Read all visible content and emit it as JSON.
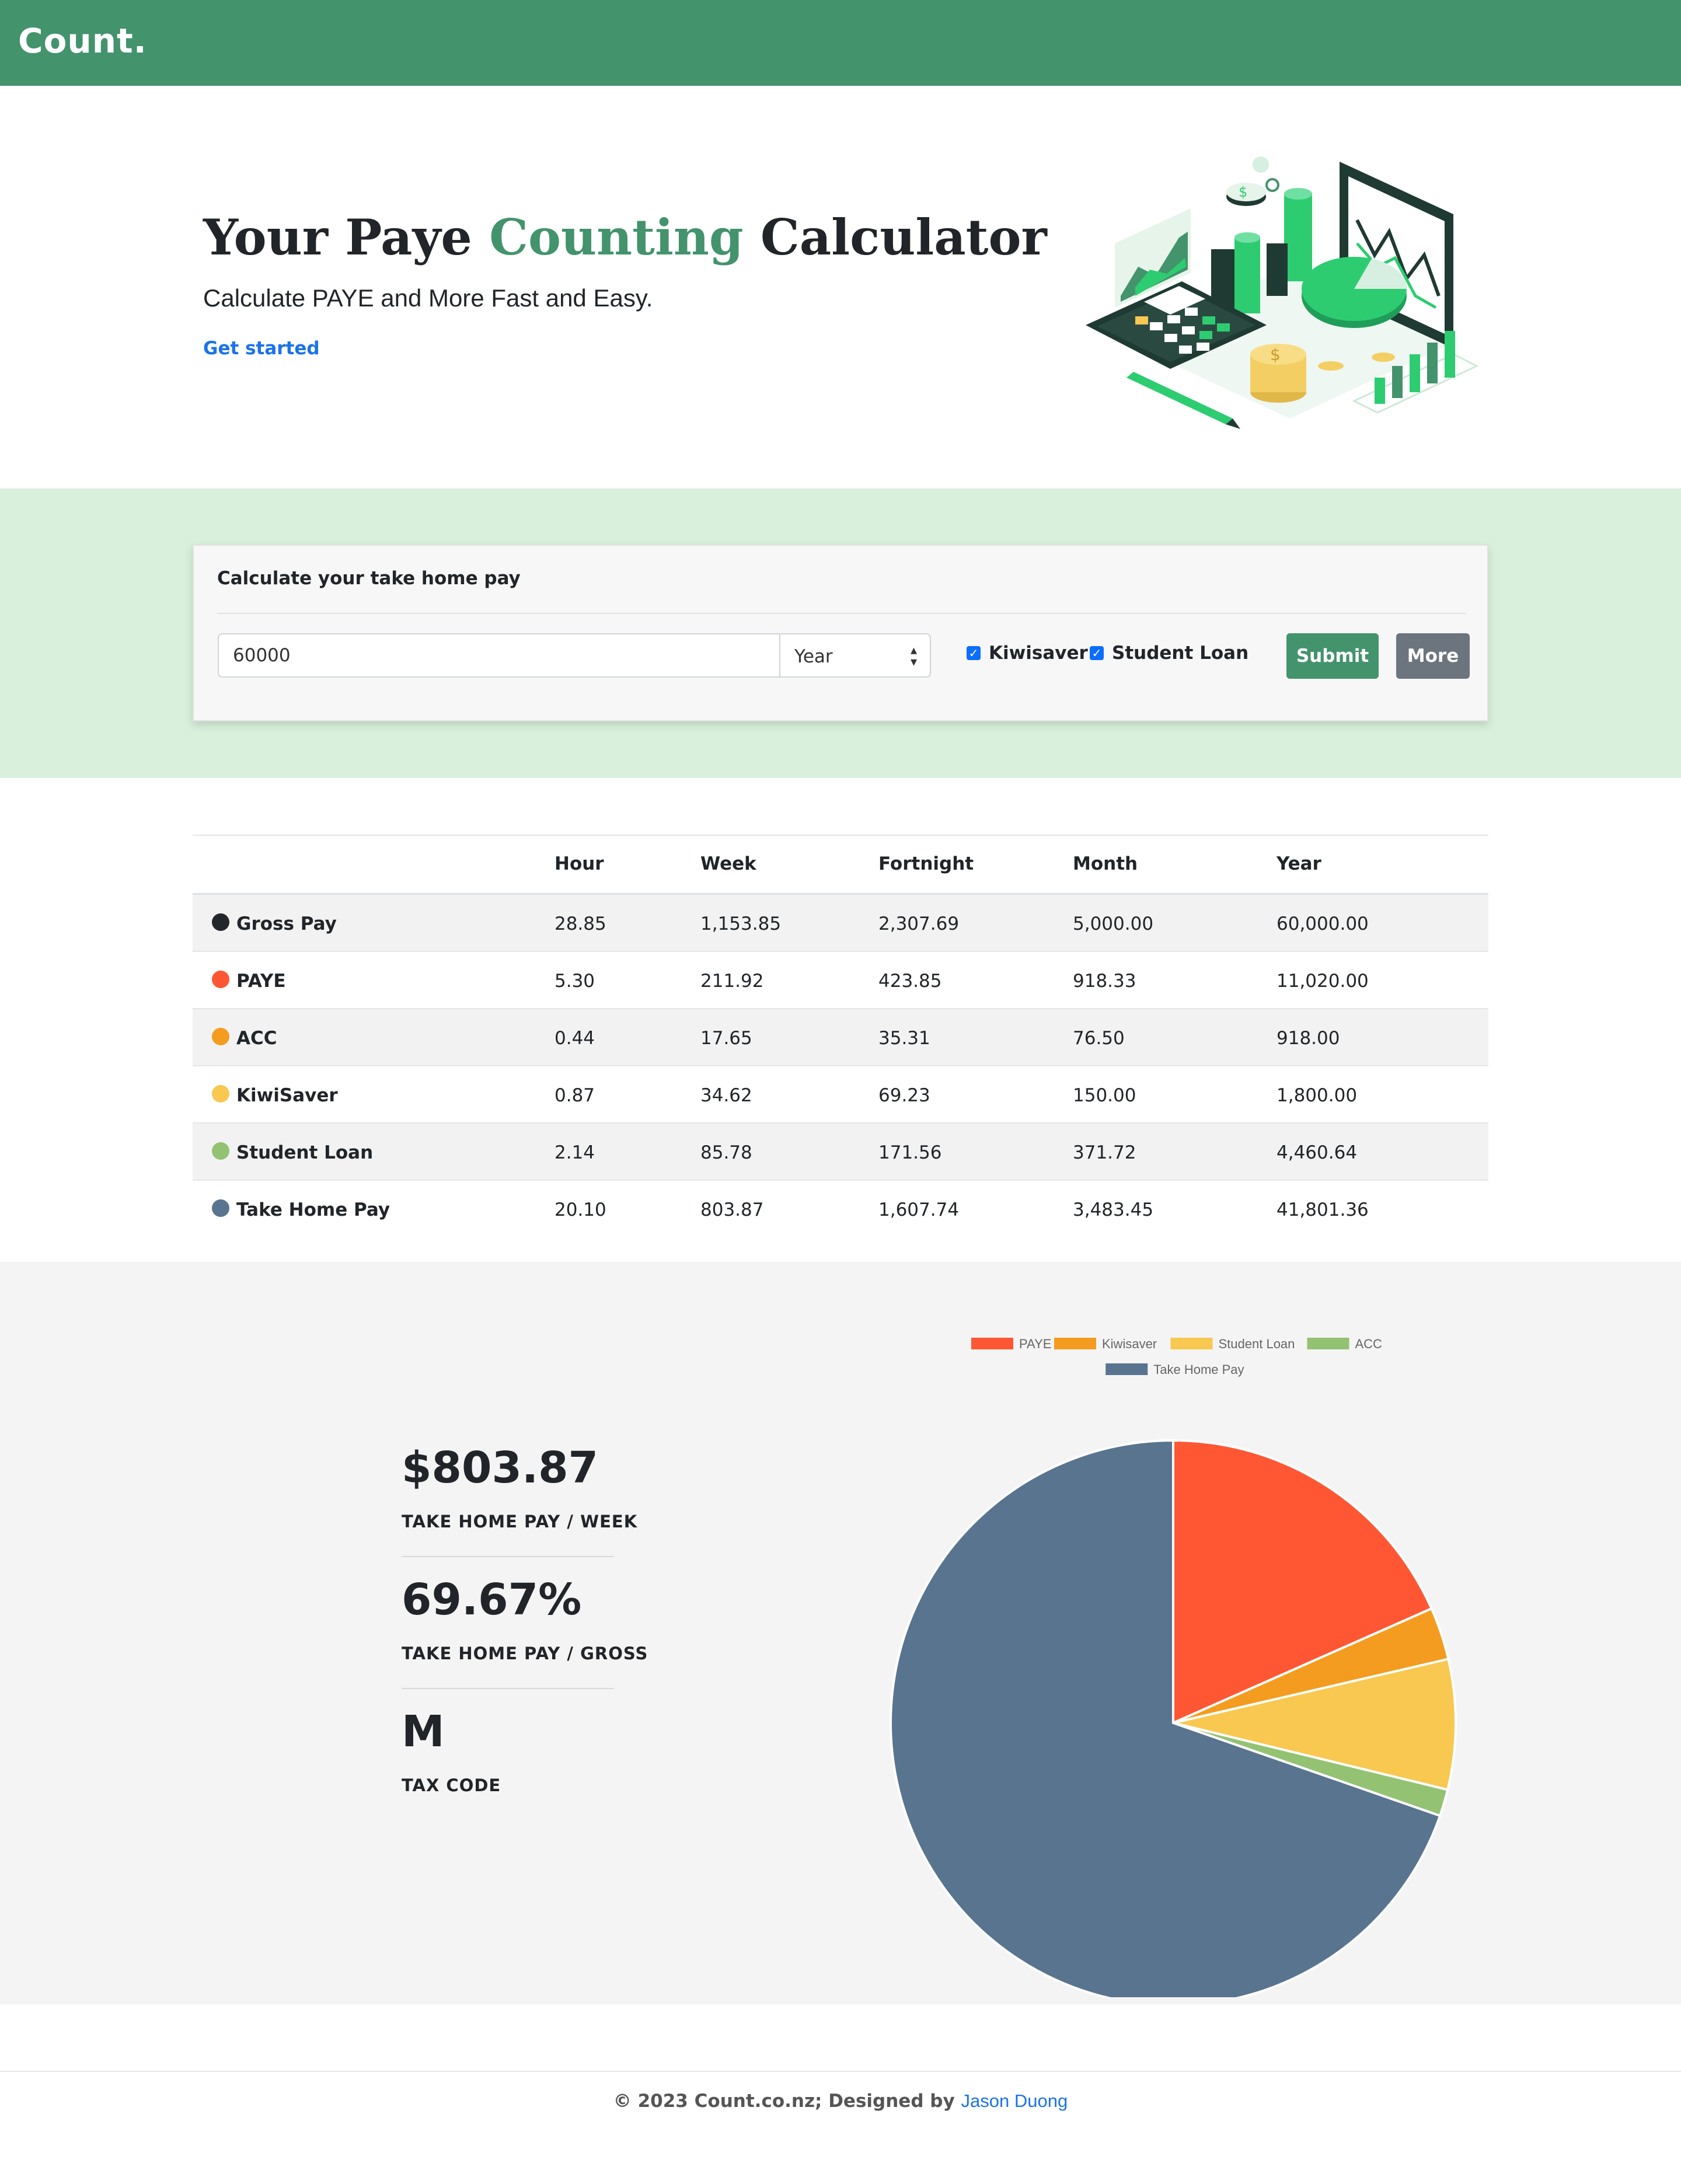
{
  "navbar": {
    "brand": "Count."
  },
  "hero": {
    "title_part1": "Your Paye ",
    "title_accent": "Counting",
    "title_part2": " Calculator",
    "subtitle": "Calculate PAYE and More Fast and Easy.",
    "cta": "Get started"
  },
  "calculator": {
    "title": "Calculate your take home pay",
    "salary_value": "60000",
    "period_selected": "Year",
    "kiwisaver_label": "Kiwisaver",
    "kiwisaver_checked": true,
    "student_loan_label": "Student Loan",
    "student_loan_checked": true,
    "submit_label": "Submit",
    "more_label": "More"
  },
  "results": {
    "headers": [
      "Hour",
      "Week",
      "Fortnight",
      "Month",
      "Year"
    ],
    "rows": [
      {
        "label": "Gross Pay",
        "color": "#23272b",
        "values": [
          "28.85",
          "1,153.85",
          "2,307.69",
          "5,000.00",
          "60,000.00"
        ]
      },
      {
        "label": "PAYE",
        "color": "#ff5733",
        "values": [
          "5.30",
          "211.92",
          "423.85",
          "918.33",
          "11,020.00"
        ]
      },
      {
        "label": "ACC",
        "color": "#f39c1f",
        "values": [
          "0.44",
          "17.65",
          "35.31",
          "76.50",
          "918.00"
        ]
      },
      {
        "label": "KiwiSaver",
        "color": "#f8c850",
        "values": [
          "0.87",
          "34.62",
          "69.23",
          "150.00",
          "1,800.00"
        ]
      },
      {
        "label": "Student Loan",
        "color": "#94c273",
        "values": [
          "2.14",
          "85.78",
          "171.56",
          "371.72",
          "4,460.64"
        ]
      },
      {
        "label": "Take Home Pay",
        "color": "#58748f",
        "values": [
          "20.10",
          "803.87",
          "1,607.74",
          "3,483.45",
          "41,801.36"
        ]
      }
    ]
  },
  "summary": {
    "take_home_week": "$803.87",
    "take_home_week_label": "TAKE HOME PAY / WEEK",
    "take_home_ratio": "69.67%",
    "take_home_ratio_label": "TAKE HOME PAY / GROSS",
    "tax_code": "M",
    "tax_code_label": "TAX CODE"
  },
  "chart_data": {
    "type": "pie",
    "legend": [
      "PAYE",
      "Kiwisaver",
      "Student Loan",
      "ACC",
      "Take Home Pay"
    ],
    "values": [
      11020.0,
      1800.0,
      4460.64,
      918.0,
      41801.36
    ],
    "colors": [
      "#ff5733",
      "#f39c1f",
      "#f8c850",
      "#94c273",
      "#58748f"
    ],
    "legend_position": "top"
  },
  "footer": {
    "text": "© 2023 Count.co.nz; Designed by ",
    "author": "Jason Duong"
  }
}
